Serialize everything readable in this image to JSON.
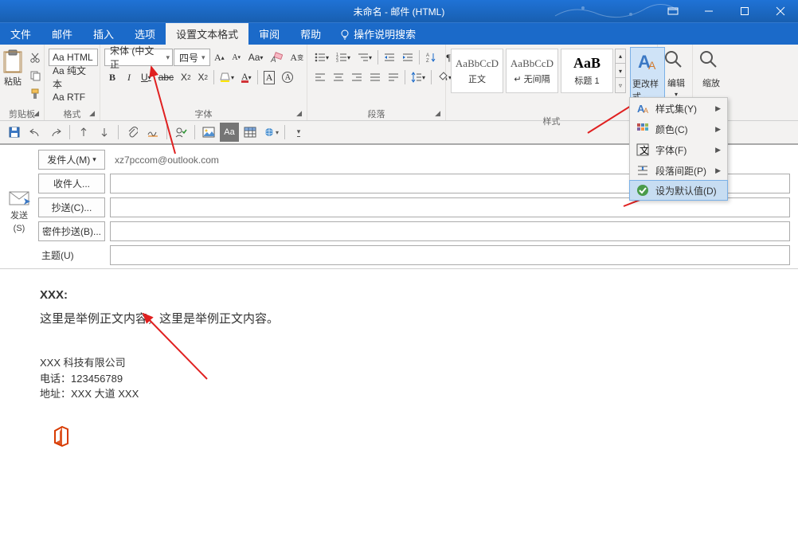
{
  "window": {
    "title": "未命名 - 邮件 (HTML)"
  },
  "menu": {
    "file": "文件",
    "mail": "邮件",
    "insert": "插入",
    "options": "选项",
    "formatText": "设置文本格式",
    "review": "审阅",
    "help": "帮助",
    "tellMe": "操作说明搜索"
  },
  "ribbon": {
    "clipboard": {
      "label": "剪贴板",
      "paste": "粘贴"
    },
    "format": {
      "label": "格式",
      "html": "Aa HTML",
      "plain": "Aa 纯文本",
      "rtf": "Aa RTF"
    },
    "font": {
      "label": "字体",
      "name": "宋体 (中文正",
      "size": "四号",
      "bold": "B",
      "italic": "I",
      "underline": "U",
      "strike": "abc"
    },
    "paragraph": {
      "label": "段落"
    },
    "styles": {
      "label": "样式",
      "items": [
        {
          "preview": "AaBbCcD",
          "name": "正文"
        },
        {
          "preview": "AaBbCcD",
          "name": "↵ 无间隔"
        },
        {
          "preview": "AaB",
          "name": "标题 1"
        }
      ],
      "changeStyle": "更改样式"
    },
    "edit": {
      "label": "编辑"
    },
    "zoom": {
      "label": "缩放"
    }
  },
  "dropdown": {
    "styleSet": "样式集(Y)",
    "color": "颜色(C)",
    "font": "字体(F)",
    "paragraphSpacing": "段落间距(P)",
    "setDefault": "设为默认值(D)"
  },
  "envelope": {
    "send": "发送",
    "sendKey": "(S)",
    "from": "发件人(M)",
    "fromValue": "xz7pccom@outlook.com",
    "to": "收件人...",
    "cc": "抄送(C)...",
    "bcc": "密件抄送(B)...",
    "subject": "主题(U)"
  },
  "bodyContent": {
    "salutation": "XXX:",
    "paragraph": "这里是举例正文内容，这里是举例正文内容。",
    "sigCompany": "XXX 科技有限公司",
    "sigPhone": "电话：123456789",
    "sigAddress": "地址：XXX 大道 XXX"
  }
}
